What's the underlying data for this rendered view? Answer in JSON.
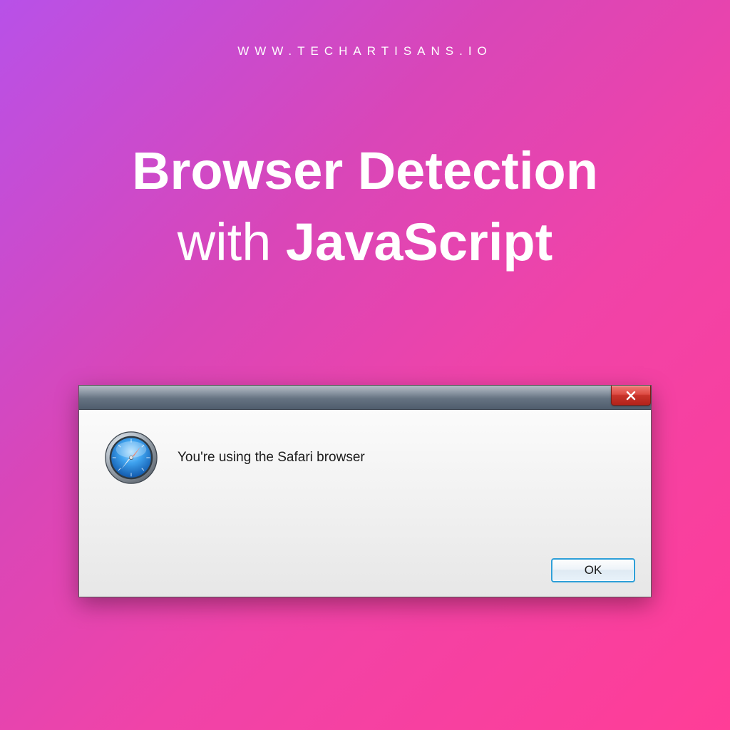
{
  "header": {
    "url": "WWW.TECHARTISANS.IO"
  },
  "headline": {
    "line1": "Browser Detection",
    "line2_prefix": "with ",
    "line2_bold": "JavaScript"
  },
  "dialog": {
    "icon": "safari-icon",
    "message": "You're using the Safari browser",
    "ok_label": "OK",
    "close_label": "x"
  }
}
